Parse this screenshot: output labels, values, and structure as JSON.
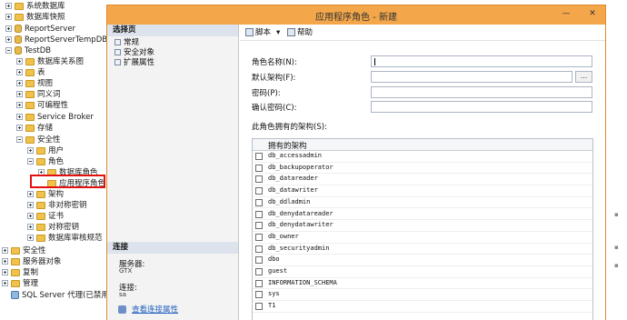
{
  "tree": {
    "items": [
      {
        "label": "系统数据库",
        "indent": 0,
        "expander": "plus",
        "icon": "folder"
      },
      {
        "label": "数据库快照",
        "indent": 0,
        "expander": "plus",
        "icon": "folder"
      },
      {
        "label": "ReportServer",
        "indent": 0,
        "expander": "plus",
        "icon": "database"
      },
      {
        "label": "ReportServerTempDB",
        "indent": 0,
        "expander": "plus",
        "icon": "database"
      },
      {
        "label": "TestDB",
        "indent": 0,
        "expander": "minus",
        "icon": "database"
      },
      {
        "label": "数据库关系图",
        "indent": 1,
        "expander": "plus",
        "icon": "folder"
      },
      {
        "label": "表",
        "indent": 1,
        "expander": "plus",
        "icon": "folder"
      },
      {
        "label": "视图",
        "indent": 1,
        "expander": "plus",
        "icon": "folder"
      },
      {
        "label": "同义词",
        "indent": 1,
        "expander": "plus",
        "icon": "folder"
      },
      {
        "label": "可编程性",
        "indent": 1,
        "expander": "plus",
        "icon": "folder"
      },
      {
        "label": "Service Broker",
        "indent": 1,
        "expander": "plus",
        "icon": "folder"
      },
      {
        "label": "存储",
        "indent": 1,
        "expander": "plus",
        "icon": "folder"
      },
      {
        "label": "安全性",
        "indent": 1,
        "expander": "minus",
        "icon": "folder"
      },
      {
        "label": "用户",
        "indent": 2,
        "expander": "plus",
        "icon": "folder"
      },
      {
        "label": "角色",
        "indent": 2,
        "expander": "minus",
        "icon": "folder"
      },
      {
        "label": "数据库角色",
        "indent": 3,
        "expander": "plus",
        "icon": "folder"
      },
      {
        "label": "应用程序角色",
        "indent": 3,
        "expander": "none",
        "icon": "folder"
      },
      {
        "label": "架构",
        "indent": 2,
        "expander": "plus",
        "icon": "folder"
      },
      {
        "label": "非对称密钥",
        "indent": 2,
        "expander": "plus",
        "icon": "folder"
      },
      {
        "label": "证书",
        "indent": 2,
        "expander": "plus",
        "icon": "folder"
      },
      {
        "label": "对称密钥",
        "indent": 2,
        "expander": "plus",
        "icon": "folder"
      },
      {
        "label": "数据库审核规范",
        "indent": 2,
        "expander": "plus",
        "icon": "folder"
      },
      {
        "label": "安全性",
        "indent": -1,
        "expander": "plus",
        "icon": "folder"
      },
      {
        "label": "服务器对象",
        "indent": -1,
        "expander": "plus",
        "icon": "folder"
      },
      {
        "label": "复制",
        "indent": -1,
        "expander": "plus",
        "icon": "folder"
      },
      {
        "label": "管理",
        "indent": -1,
        "expander": "plus",
        "icon": "folder"
      },
      {
        "label": "SQL Server 代理(已禁用代理 )",
        "indent": -1,
        "expander": "none",
        "icon": "agent"
      }
    ]
  },
  "dialog": {
    "title": "应用程序角色 - 新建",
    "minimize_label": "—",
    "close_label": "✕",
    "left": {
      "select_page_header": "选择页",
      "pages": [
        "常规",
        "安全对象",
        "扩展属性"
      ],
      "connection_header": "连接",
      "server_label": "服务器:",
      "server_value": "GTX",
      "connection_label": "连接:",
      "connection_value": "sa",
      "view_props_link": "查看连接属性"
    },
    "toolbar": {
      "script_label": "脚本",
      "script_dropdown": "▾",
      "help_label": "帮助"
    },
    "form": {
      "role_name_label": "角色名称(N):",
      "role_name_value": "",
      "default_schema_label": "默认架构(F):",
      "default_schema_value": "",
      "browse_label": "...",
      "password_label": "密码(P):",
      "password_value": "",
      "confirm_password_label": "确认密码(C):",
      "confirm_password_value": "",
      "schemas_label": "此角色拥有的架构(S):",
      "grid_header": "拥有的架构",
      "schemas": [
        {
          "name": "db_accessadmin",
          "checked": false
        },
        {
          "name": "db_backupoperator",
          "checked": false
        },
        {
          "name": "db_datareader",
          "checked": false
        },
        {
          "name": "db_datawriter",
          "checked": false
        },
        {
          "name": "db_ddladmin",
          "checked": false
        },
        {
          "name": "db_denydatareader",
          "checked": false
        },
        {
          "name": "db_denydatawriter",
          "checked": false
        },
        {
          "name": "db_owner",
          "checked": false
        },
        {
          "name": "db_securityadmin",
          "checked": false
        },
        {
          "name": "dbo",
          "checked": false
        },
        {
          "name": "guest",
          "checked": false
        },
        {
          "name": "INFORMATION_SCHEMA",
          "checked": false
        },
        {
          "name": "sys",
          "checked": false
        },
        {
          "name": "T1",
          "checked": false
        }
      ]
    }
  },
  "colors": {
    "titlebar": "#f3a64a",
    "highlight_box": "#e31010",
    "link": "#1f5fbf",
    "pane_header": "#dde3ec"
  }
}
